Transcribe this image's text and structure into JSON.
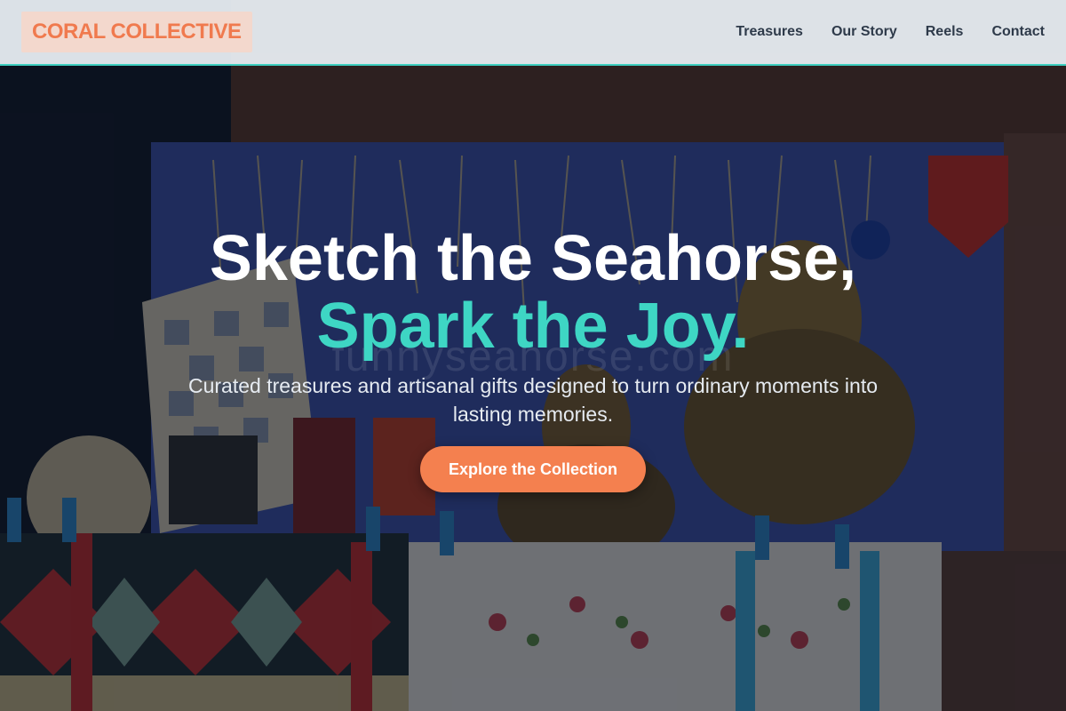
{
  "brand": {
    "name": "CORAL COLLECTIVE"
  },
  "nav": {
    "items": [
      {
        "label": "Treasures"
      },
      {
        "label": "Our Story"
      },
      {
        "label": "Reels"
      },
      {
        "label": "Contact"
      }
    ]
  },
  "hero": {
    "headline_line1": "Sketch the Seahorse,",
    "headline_line2": "Spark the Joy.",
    "watermark": "funnyseahorse.com",
    "subtitle": "Curated treasures and artisanal gifts designed to turn ordinary moments into lasting memories.",
    "cta_label": "Explore the Collection"
  },
  "colors": {
    "accent_teal": "#3ed6c4",
    "accent_coral": "#f4804f",
    "header_bg": "#ecf1f6",
    "logo_bg": "#f3d8cd"
  }
}
